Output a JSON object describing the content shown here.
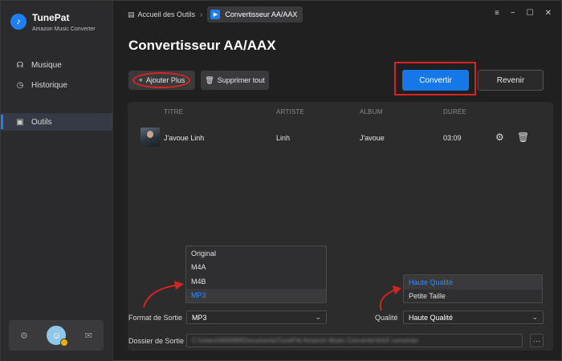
{
  "brand": {
    "name": "TunePat",
    "subtitle": "Amazon Music Converter",
    "logo_icon": "♪"
  },
  "sidebar": {
    "items": [
      {
        "label": "Musique",
        "icon": "headphones-icon",
        "glyph": "☊"
      },
      {
        "label": "Historique",
        "icon": "clock-icon",
        "glyph": "◷"
      },
      {
        "label": "Outils",
        "icon": "toolbox-icon",
        "glyph": "▣",
        "active": true
      }
    ],
    "footer": {
      "settings_glyph": "⚙",
      "mail_glyph": "✉",
      "avatar_glyph": "☺"
    }
  },
  "breadcrumb": {
    "home_glyph": "▤",
    "home": "Accueil des Outils",
    "separator": "›",
    "current_glyph": "▶",
    "current": "Convertisseur AA/AAX"
  },
  "window_controls": {
    "menu": "≡",
    "minimize": "−",
    "maximize": "☐",
    "close": "✕"
  },
  "page": {
    "title": "Convertisseur AA/AAX"
  },
  "toolbar": {
    "add_label": "Ajouter Plus",
    "add_glyph": "+",
    "delete_label": "Supprimer tout",
    "delete_glyph": "🗑",
    "convert_label": "Convertir",
    "back_label": "Revenir"
  },
  "table": {
    "headers": {
      "title": "TITRE",
      "artist": "ARTISTE",
      "album": "ALBUM",
      "duration": "DURÉE"
    },
    "rows": [
      {
        "title": "J'avoue Linh",
        "artist": "Linh",
        "album": "J'avoue",
        "duration": "03:09",
        "settings_glyph": "⚙",
        "delete_glyph": "🗑"
      }
    ]
  },
  "format_dropdown": {
    "options": [
      "Original",
      "M4A",
      "M4B",
      "MP3"
    ],
    "selected": "MP3"
  },
  "quality_dropdown": {
    "options": [
      "Haute Qualité",
      "Petite Taille"
    ],
    "selected": "Haute Qualité"
  },
  "settings": {
    "format_label": "Format de Sortie",
    "format_value": "MP3",
    "quality_label": "Qualité",
    "quality_value": "Haute Qualité",
    "folder_label": "Dossier de Sortie",
    "folder_path": "C:\\Users\\WWMM\\Documents\\TunePat Amazon Music Converter\\AAX converter",
    "more_label": "···",
    "chevron": "⌄"
  },
  "colors": {
    "accent": "#1677e8",
    "highlight": "#d42424",
    "selected_text": "#2f8cf0"
  }
}
